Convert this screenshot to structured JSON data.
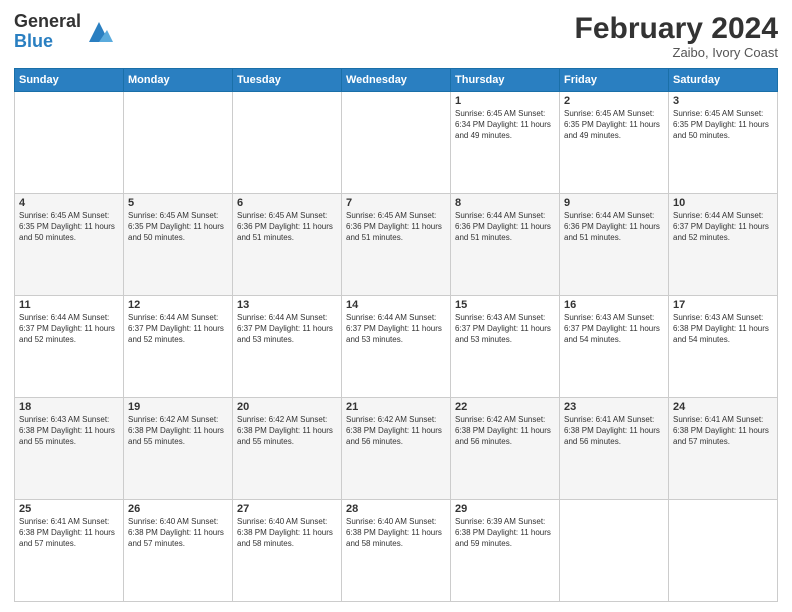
{
  "header": {
    "logo_general": "General",
    "logo_blue": "Blue",
    "month_title": "February 2024",
    "location": "Zaibo, Ivory Coast"
  },
  "days_of_week": [
    "Sunday",
    "Monday",
    "Tuesday",
    "Wednesday",
    "Thursday",
    "Friday",
    "Saturday"
  ],
  "weeks": [
    [
      {
        "day": "",
        "info": ""
      },
      {
        "day": "",
        "info": ""
      },
      {
        "day": "",
        "info": ""
      },
      {
        "day": "",
        "info": ""
      },
      {
        "day": "1",
        "info": "Sunrise: 6:45 AM\nSunset: 6:34 PM\nDaylight: 11 hours and 49 minutes."
      },
      {
        "day": "2",
        "info": "Sunrise: 6:45 AM\nSunset: 6:35 PM\nDaylight: 11 hours and 49 minutes."
      },
      {
        "day": "3",
        "info": "Sunrise: 6:45 AM\nSunset: 6:35 PM\nDaylight: 11 hours and 50 minutes."
      }
    ],
    [
      {
        "day": "4",
        "info": "Sunrise: 6:45 AM\nSunset: 6:35 PM\nDaylight: 11 hours and 50 minutes."
      },
      {
        "day": "5",
        "info": "Sunrise: 6:45 AM\nSunset: 6:35 PM\nDaylight: 11 hours and 50 minutes."
      },
      {
        "day": "6",
        "info": "Sunrise: 6:45 AM\nSunset: 6:36 PM\nDaylight: 11 hours and 51 minutes."
      },
      {
        "day": "7",
        "info": "Sunrise: 6:45 AM\nSunset: 6:36 PM\nDaylight: 11 hours and 51 minutes."
      },
      {
        "day": "8",
        "info": "Sunrise: 6:44 AM\nSunset: 6:36 PM\nDaylight: 11 hours and 51 minutes."
      },
      {
        "day": "9",
        "info": "Sunrise: 6:44 AM\nSunset: 6:36 PM\nDaylight: 11 hours and 51 minutes."
      },
      {
        "day": "10",
        "info": "Sunrise: 6:44 AM\nSunset: 6:37 PM\nDaylight: 11 hours and 52 minutes."
      }
    ],
    [
      {
        "day": "11",
        "info": "Sunrise: 6:44 AM\nSunset: 6:37 PM\nDaylight: 11 hours and 52 minutes."
      },
      {
        "day": "12",
        "info": "Sunrise: 6:44 AM\nSunset: 6:37 PM\nDaylight: 11 hours and 52 minutes."
      },
      {
        "day": "13",
        "info": "Sunrise: 6:44 AM\nSunset: 6:37 PM\nDaylight: 11 hours and 53 minutes."
      },
      {
        "day": "14",
        "info": "Sunrise: 6:44 AM\nSunset: 6:37 PM\nDaylight: 11 hours and 53 minutes."
      },
      {
        "day": "15",
        "info": "Sunrise: 6:43 AM\nSunset: 6:37 PM\nDaylight: 11 hours and 53 minutes."
      },
      {
        "day": "16",
        "info": "Sunrise: 6:43 AM\nSunset: 6:37 PM\nDaylight: 11 hours and 54 minutes."
      },
      {
        "day": "17",
        "info": "Sunrise: 6:43 AM\nSunset: 6:38 PM\nDaylight: 11 hours and 54 minutes."
      }
    ],
    [
      {
        "day": "18",
        "info": "Sunrise: 6:43 AM\nSunset: 6:38 PM\nDaylight: 11 hours and 55 minutes."
      },
      {
        "day": "19",
        "info": "Sunrise: 6:42 AM\nSunset: 6:38 PM\nDaylight: 11 hours and 55 minutes."
      },
      {
        "day": "20",
        "info": "Sunrise: 6:42 AM\nSunset: 6:38 PM\nDaylight: 11 hours and 55 minutes."
      },
      {
        "day": "21",
        "info": "Sunrise: 6:42 AM\nSunset: 6:38 PM\nDaylight: 11 hours and 56 minutes."
      },
      {
        "day": "22",
        "info": "Sunrise: 6:42 AM\nSunset: 6:38 PM\nDaylight: 11 hours and 56 minutes."
      },
      {
        "day": "23",
        "info": "Sunrise: 6:41 AM\nSunset: 6:38 PM\nDaylight: 11 hours and 56 minutes."
      },
      {
        "day": "24",
        "info": "Sunrise: 6:41 AM\nSunset: 6:38 PM\nDaylight: 11 hours and 57 minutes."
      }
    ],
    [
      {
        "day": "25",
        "info": "Sunrise: 6:41 AM\nSunset: 6:38 PM\nDaylight: 11 hours and 57 minutes."
      },
      {
        "day": "26",
        "info": "Sunrise: 6:40 AM\nSunset: 6:38 PM\nDaylight: 11 hours and 57 minutes."
      },
      {
        "day": "27",
        "info": "Sunrise: 6:40 AM\nSunset: 6:38 PM\nDaylight: 11 hours and 58 minutes."
      },
      {
        "day": "28",
        "info": "Sunrise: 6:40 AM\nSunset: 6:38 PM\nDaylight: 11 hours and 58 minutes."
      },
      {
        "day": "29",
        "info": "Sunrise: 6:39 AM\nSunset: 6:38 PM\nDaylight: 11 hours and 59 minutes."
      },
      {
        "day": "",
        "info": ""
      },
      {
        "day": "",
        "info": ""
      }
    ]
  ]
}
